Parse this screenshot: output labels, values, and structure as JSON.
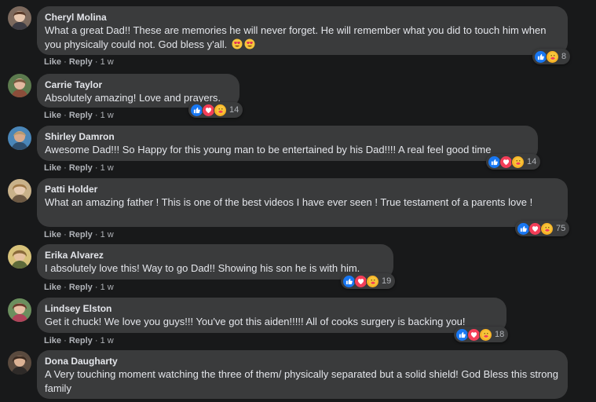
{
  "comments": [
    {
      "author": "Cheryl Molina",
      "text": "What a great Dad!! These are memories he will never forget. He will remember what you did to touch him when you physically could not. God bless y'all.",
      "emoji": [
        "heart-eyes-emoji",
        "heart-eyes-emoji"
      ],
      "like": "Like",
      "reply": "Reply",
      "time": "1 w",
      "react_count": "8",
      "reactions": [
        "like",
        "care"
      ]
    },
    {
      "author": "Carrie Taylor",
      "text": "Absolutely amazing! Love and prayers.",
      "like": "Like",
      "reply": "Reply",
      "time": "1 w",
      "react_count": "14",
      "reactions": [
        "like",
        "love",
        "care"
      ]
    },
    {
      "author": "Shirley Damron",
      "text": "Awesome Dad!!! So Happy for this young man to be entertained by his Dad!!!! A real feel good time",
      "like": "Like",
      "reply": "Reply",
      "time": "1 w",
      "react_count": "14",
      "reactions": [
        "like",
        "love",
        "care"
      ]
    },
    {
      "author": "Patti Holder",
      "text": "What an amazing father ! This is one of the best videos I have ever seen ! True testament of a parents love !",
      "like": "Like",
      "reply": "Reply",
      "time": "1 w",
      "react_count": "75",
      "reactions": [
        "like",
        "love",
        "care"
      ]
    },
    {
      "author": "Erika Alvarez",
      "text": "I absolutely love this! Way to go Dad!! Showing his son he is with him.",
      "like": "Like",
      "reply": "Reply",
      "time": "1 w",
      "react_count": "19",
      "reactions": [
        "like",
        "love",
        "care"
      ]
    },
    {
      "author": "Lindsey Elston",
      "text": "Get it chuck! We love you guys!!! You've got this aiden!!!!! All of cooks surgery is backing you!",
      "like": "Like",
      "reply": "Reply",
      "time": "1 w",
      "react_count": "18",
      "reactions": [
        "like",
        "love",
        "care"
      ]
    },
    {
      "author": "Dona Daugharty",
      "text": "A Very touching moment watching the three of them/ physically separated but a solid shield! God Bless this strong family"
    }
  ],
  "colors": {
    "background": "#18191a",
    "bubble": "#3a3b3c",
    "like": "#1877f2",
    "love": "#f33e58",
    "care": "#f7b125",
    "meta": "#b0b3b8"
  },
  "separator": "·"
}
